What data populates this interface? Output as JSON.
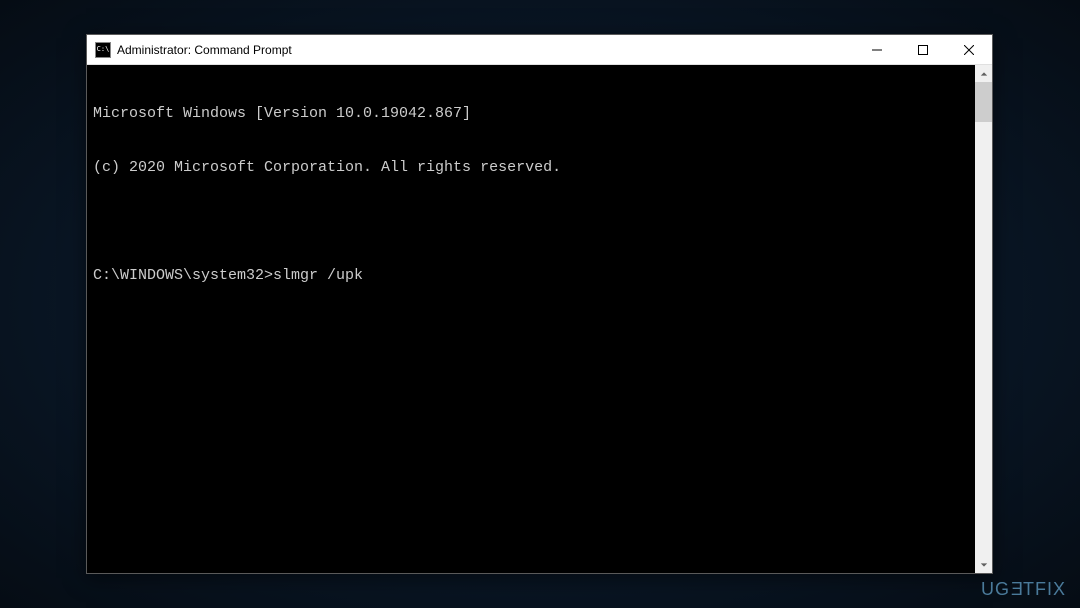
{
  "window": {
    "title": "Administrator: Command Prompt",
    "icon_text": "C:\\"
  },
  "terminal": {
    "line1": "Microsoft Windows [Version 10.0.19042.867]",
    "line2": "(c) 2020 Microsoft Corporation. All rights reserved.",
    "prompt": "C:\\WINDOWS\\system32>",
    "command": "slmgr /upk"
  },
  "watermark": {
    "text_pre": "UG",
    "text_e": "E",
    "text_post": "TFIX"
  }
}
